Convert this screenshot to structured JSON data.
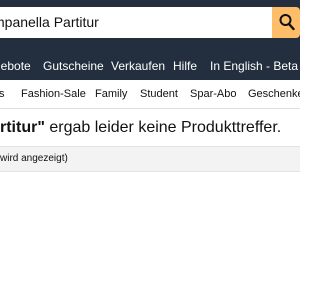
{
  "search": {
    "query_visible": "mpanella Partitur",
    "search_icon": "magnifier-icon",
    "accent": "#febd69"
  },
  "nav": {
    "items": [
      "gebote",
      "Gutscheine",
      "Verkaufen",
      "Hilfe",
      "In English - Beta"
    ]
  },
  "subnav": {
    "items": [
      "s",
      "Fashion-Sale",
      "Family",
      "Student",
      "Spar-Abo",
      "Geschenke"
    ]
  },
  "result": {
    "query_fragment": "rtitur\"",
    "message": " ergab leider keine Produkttreffer."
  },
  "hint": {
    "text": "wird angezeigt)"
  },
  "colors": {
    "header_bg": "#232f3e",
    "search_button": "#febd69"
  }
}
